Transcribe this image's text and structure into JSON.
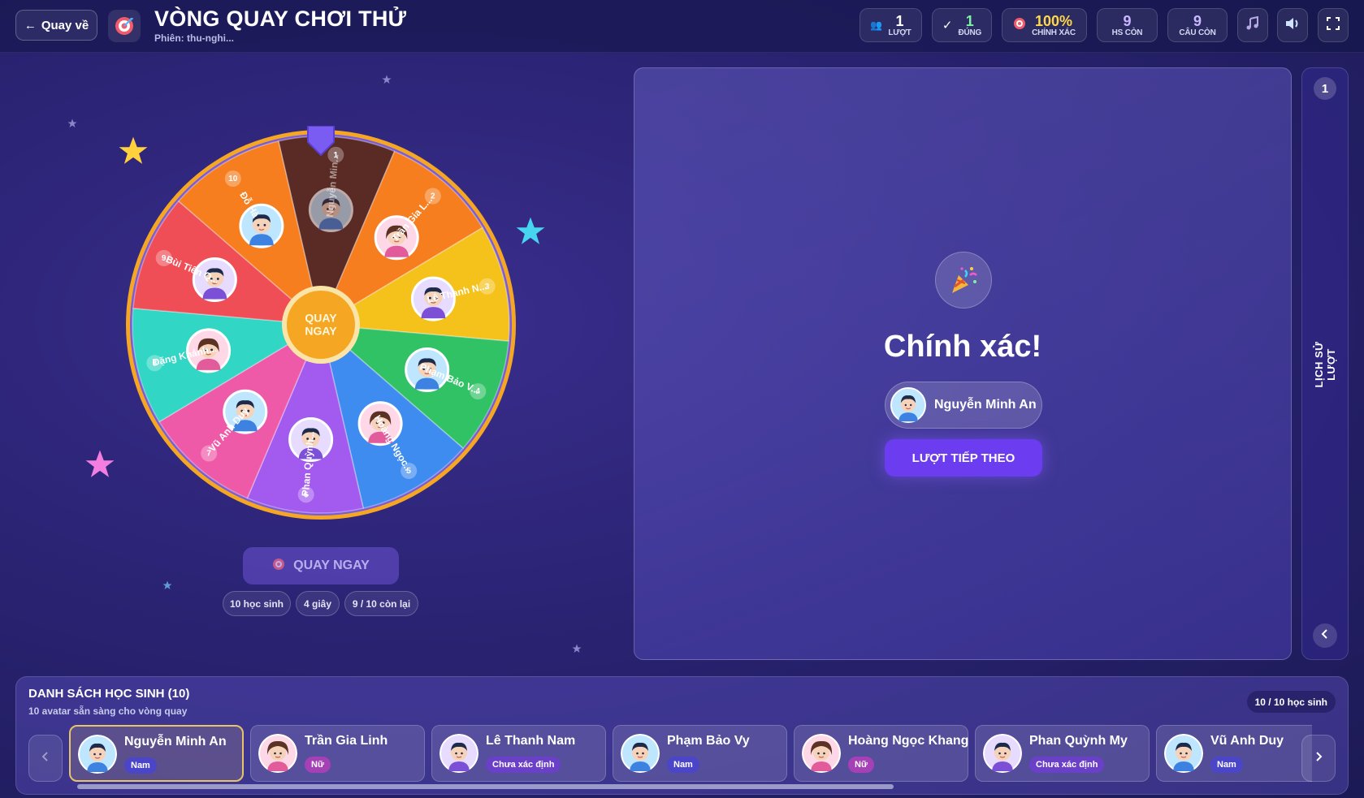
{
  "header": {
    "back_label": "Quay về",
    "title": "VÒNG QUAY CHƠI THỬ",
    "session": "Phiên: thu-nghi...",
    "stats": [
      {
        "num": "1",
        "label": "LƯỢT",
        "icon": "users-icon"
      },
      {
        "num": "1",
        "label": "ĐÚNG",
        "icon": "check-icon"
      },
      {
        "num": "100%",
        "label": "CHÍNH XÁC",
        "icon": "target-icon"
      },
      {
        "num": "9",
        "label": "HS CÒN"
      },
      {
        "num": "9",
        "label": "CÂU CÒN"
      }
    ],
    "buttons": [
      "music-icon",
      "volume-icon",
      "fullscreen-icon"
    ]
  },
  "wheel": {
    "center_label": "QUAY NGAY",
    "segments": [
      {
        "n": "1",
        "name": "Nguyễn Min...",
        "color": "#5a2a24"
      },
      {
        "n": "2",
        "name": "Trần Gia L...",
        "color": "#f77e1f"
      },
      {
        "n": "3",
        "name": "Lê Thanh N...",
        "color": "#f5c21b"
      },
      {
        "n": "4",
        "name": "Phạm Bảo V...",
        "color": "#32c266"
      },
      {
        "n": "5",
        "name": "Hoàng Ngọc...",
        "color": "#3f8cf0"
      },
      {
        "n": "6",
        "name": "Phan Quỳnh...",
        "color": "#a35bef"
      },
      {
        "n": "7",
        "name": "Vũ Anh Duy",
        "color": "#ef5aa8"
      },
      {
        "n": "8",
        "name": "Đặng Khánh...",
        "color": "#31d6c4"
      },
      {
        "n": "9",
        "name": "Bùi Tiến Q...",
        "color": "#f04e56"
      },
      {
        "n": "10",
        "name": "Đỗ Hà",
        "color": "#f77e1f"
      }
    ]
  },
  "controls": {
    "spin_label": "QUAY NGAY",
    "chips": [
      "10 học sinh",
      "4 giây",
      "9 / 10 còn lại"
    ]
  },
  "result": {
    "title": "Chính xác!",
    "winner": "Nguyễn Minh An",
    "next_label": "LƯỢT TIẾP THEO"
  },
  "history": {
    "count": "1",
    "label": "LỊCH SỬ LƯỢT"
  },
  "students": {
    "title": "DANH SÁCH HỌC SINH (10)",
    "subtitle": "10 avatar sẵn sàng cho vòng quay",
    "count_label": "10 / 10 học sinh",
    "list": [
      {
        "name": "Nguyễn Minh An",
        "tag": "Nam",
        "kind": "nam",
        "active": true
      },
      {
        "name": "Trần Gia Linh",
        "tag": "Nữ",
        "kind": "nu"
      },
      {
        "name": "Lê Thanh Nam",
        "tag": "Chưa xác định",
        "kind": "unk"
      },
      {
        "name": "Phạm Bảo Vy",
        "tag": "Nam",
        "kind": "nam"
      },
      {
        "name": "Hoàng Ngọc Khang",
        "tag": "Nữ",
        "kind": "nu"
      },
      {
        "name": "Phan Quỳnh My",
        "tag": "Chưa xác định",
        "kind": "unk"
      },
      {
        "name": "Vũ Anh Duy",
        "tag": "Nam",
        "kind": "nam"
      }
    ]
  },
  "colors": {
    "accent": "#6b3cf0",
    "rim": "#f5a623"
  }
}
